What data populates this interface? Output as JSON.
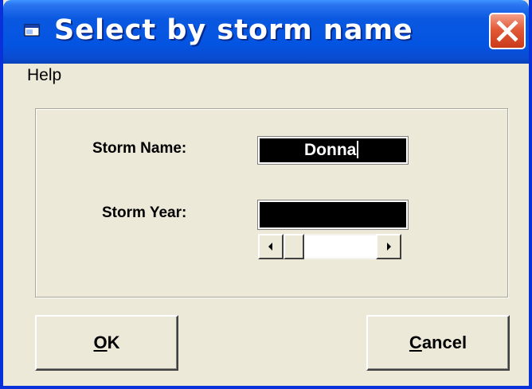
{
  "window": {
    "title": "Select by storm name"
  },
  "menu": {
    "items": [
      {
        "label": "Help"
      }
    ]
  },
  "form": {
    "storm_name_label": "Storm Name:",
    "storm_name_value": "Donna",
    "storm_year_label": "Storm Year:",
    "storm_year_value": ""
  },
  "buttons": {
    "ok": {
      "mnemonic": "O",
      "rest": "K"
    },
    "cancel": {
      "mnemonic": "C",
      "rest": "ancel"
    }
  },
  "icons": {
    "window": "app-window-icon",
    "close": "close-icon",
    "scroll_left": "left-arrow-icon",
    "scroll_right": "right-arrow-icon"
  },
  "colors": {
    "titlebar": "#0454e2",
    "close_button": "#e25a38",
    "dialog_face": "#ece9d8",
    "field_background": "#000000",
    "field_text": "#ffffff"
  }
}
